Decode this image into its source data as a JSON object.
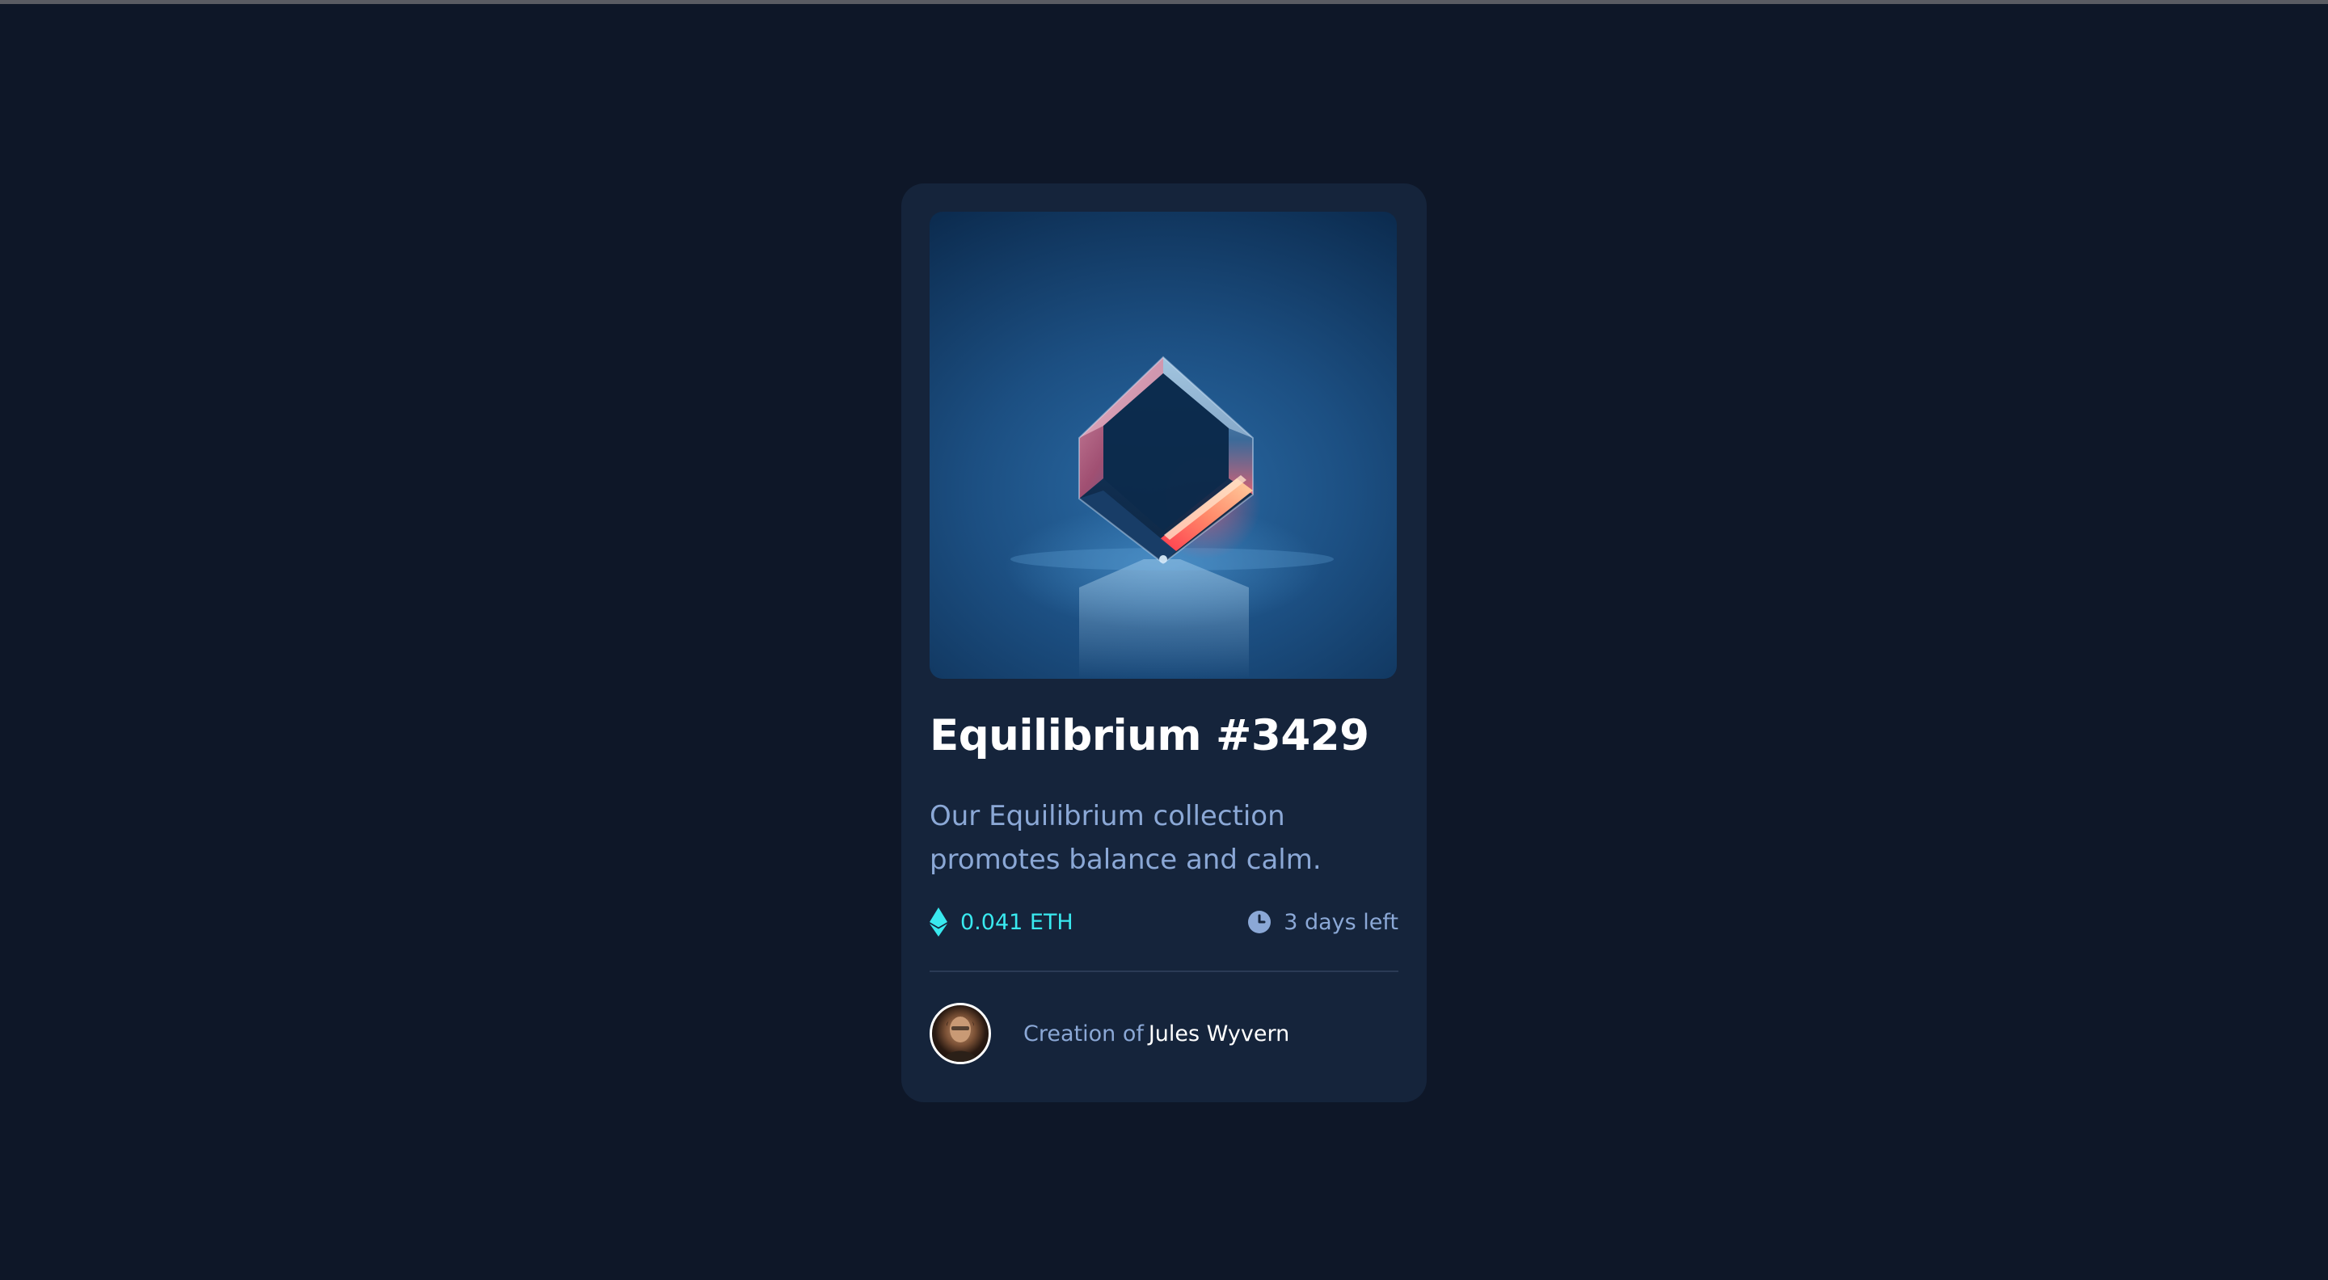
{
  "card": {
    "title": "Equilibrium #3429",
    "description": "Our Equilibrium collection promotes balance and calm.",
    "price": "0.041 ETH",
    "time_left": "3 days left",
    "creator_prefix": "Creation of",
    "creator_name": "Jules Wyvern"
  },
  "icons": {
    "price": "ethereum-icon",
    "time": "clock-icon"
  },
  "colors": {
    "page_background": "#0e1728",
    "card_background": "#15243b",
    "accent_cyan": "#39e9ef",
    "soft_blue_text": "#8ba8d6",
    "white": "#ffffff",
    "divider": "#2a3a55"
  }
}
